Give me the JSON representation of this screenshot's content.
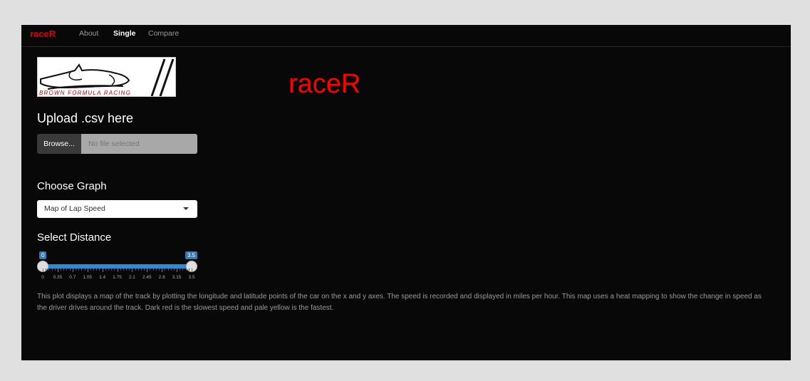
{
  "nav": {
    "brand": "raceR",
    "items": [
      {
        "label": "About",
        "active": false
      },
      {
        "label": "Single",
        "active": true
      },
      {
        "label": "Compare",
        "active": false
      }
    ]
  },
  "logo": {
    "text": "BROWN FORMULA RACING"
  },
  "main": {
    "title": "raceR"
  },
  "upload": {
    "heading": "Upload .csv here",
    "browse_label": "Browse...",
    "placeholder": "No file selected"
  },
  "graph": {
    "heading": "Choose Graph",
    "selected": "Map of Lap Speed"
  },
  "distance": {
    "heading": "Select Distance",
    "min_value": "0",
    "max_value": "3.5",
    "ticks": [
      "0",
      "0.35",
      "0.7",
      "1.05",
      "1.4",
      "1.75",
      "2.1",
      "2.45",
      "2.8",
      "3.15",
      "3.5"
    ]
  },
  "description": "This plot displays a map of the track by plotting the longitude and latitude points of the car on the x and y axes. The speed is recorded and displayed in miles per hour. This map uses a heat mapping to show the change in speed as the driver drives around the track. Dark red is the slowest speed and pale yellow is the fastest.",
  "colors": {
    "brand": "#e00000",
    "accent": "#337ab7",
    "background": "#080808"
  }
}
